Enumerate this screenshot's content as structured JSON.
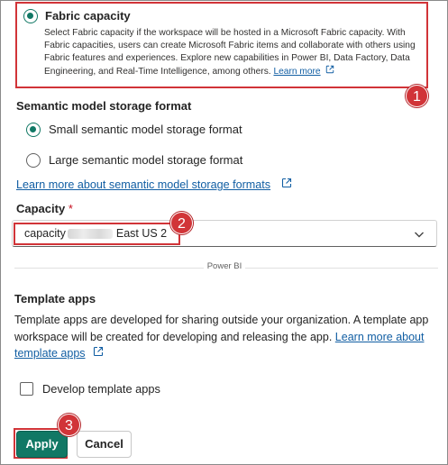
{
  "fabric": {
    "title": "Fabric capacity",
    "description": "Select Fabric capacity if the workspace will be hosted in a Microsoft Fabric capacity. With Fabric capacities, users can create Microsoft Fabric items and collaborate with others using Fabric features and experiences. Explore new capabilities in Power BI, Data Factory, Data Engineering, and Real-Time Intelligence, among others.",
    "learn_more": "Learn more",
    "selected": true
  },
  "storage": {
    "heading": "Semantic model storage format",
    "options": [
      {
        "label": "Small semantic model storage format",
        "selected": true
      },
      {
        "label": "Large semantic model storage format",
        "selected": false
      }
    ],
    "learn_more": "Learn more about semantic model storage formats"
  },
  "capacity": {
    "label": "Capacity",
    "required_mark": "*",
    "value_prefix": "capacity",
    "value_suffix": "East US 2"
  },
  "divider": "Power BI",
  "template_apps": {
    "heading": "Template apps",
    "description": "Template apps are developed for sharing outside your organization. A template app workspace will be created for developing and releasing the app.",
    "learn_more": "Learn more about template apps",
    "checkbox_label": "Develop template apps",
    "checked": false
  },
  "buttons": {
    "apply": "Apply",
    "cancel": "Cancel"
  },
  "callouts": [
    "1",
    "2",
    "3"
  ],
  "colors": {
    "accent": "#117865",
    "highlight": "#d13438",
    "link": "#115ea3"
  }
}
